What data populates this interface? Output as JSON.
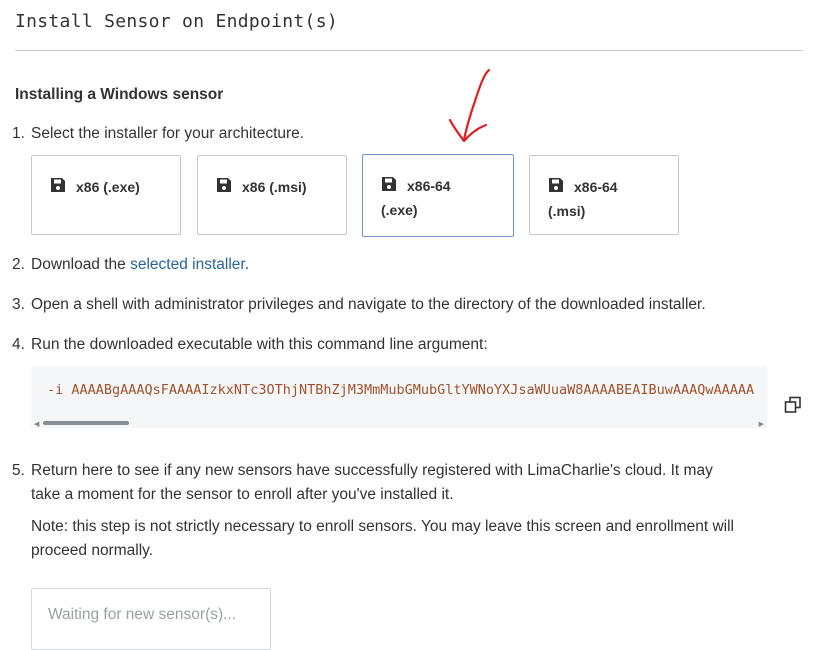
{
  "header": {
    "title": "Install Sensor on Endpoint(s)"
  },
  "section": {
    "heading": "Installing a Windows sensor"
  },
  "steps": {
    "s1": {
      "num": "1.",
      "text": "Select the installer for your architecture."
    },
    "s2": {
      "num": "2.",
      "text_before": "Download the ",
      "link": "selected installer",
      "text_after": "."
    },
    "s3": {
      "num": "3.",
      "text": "Open a shell with administrator privileges and navigate to the directory of the downloaded installer."
    },
    "s4": {
      "num": "4.",
      "text": "Run the downloaded executable with this command line argument:"
    },
    "s5": {
      "num": "5.",
      "line1": "Return here to see if any new sensors have successfully registered with LimaCharlie's cloud. It may",
      "line2": "take a moment for the sensor to enroll after you've installed it.",
      "note1": "Note: this step is not strictly necessary to enroll sensors. You may leave this screen and enrollment will",
      "note2": "proceed normally."
    }
  },
  "installers": [
    {
      "line1": "x86 (.exe)",
      "line2": "",
      "selected": false
    },
    {
      "line1": "x86 (.msi)",
      "line2": "",
      "selected": false
    },
    {
      "line1": "x86-64",
      "line2": "(.exe)",
      "selected": true
    },
    {
      "line1": "x86-64",
      "line2": "(.msi)",
      "selected": false
    }
  ],
  "command": {
    "text": "-i AAAABgAAAQsFAAAAIzkxNTc3OThjNTBhZjM3MmMubGMubGltYWNoYXJsaWUuaW8AAAABEAIBuwAAAQwAAAAA"
  },
  "waiting": {
    "text": "Waiting for new sensor(s)..."
  },
  "icons": {
    "installer": "floppy-save-icon",
    "copy": "copy-icon",
    "annotation": "red-arrow-annotation"
  },
  "colors": {
    "link": "#2a6496",
    "code": "#a0522d",
    "selected_border": "#7396bf",
    "annotation": "#e02020"
  }
}
